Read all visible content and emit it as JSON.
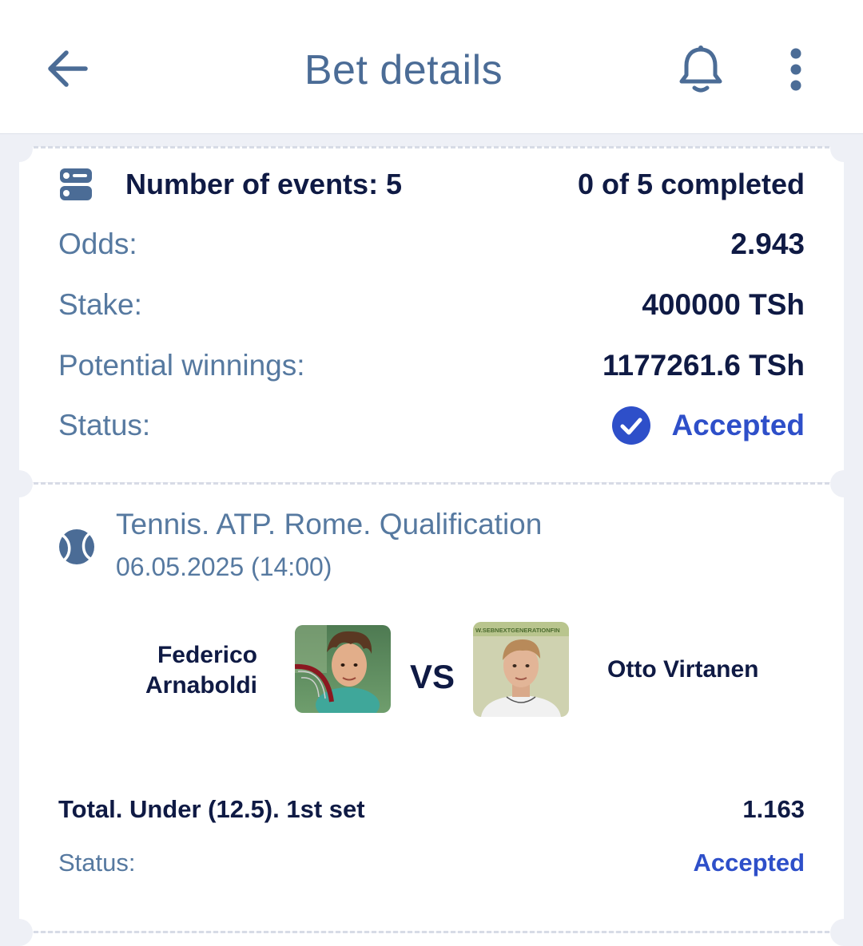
{
  "header": {
    "title": "Bet details",
    "back_icon": "arrow-left-icon",
    "bell_icon": "bell-icon",
    "more_icon": "more-vertical-icon"
  },
  "summary": {
    "events_label": "Number of events: 5",
    "completed": "0 of 5 completed",
    "odds_label": "Odds:",
    "odds_value": "2.943",
    "stake_label": "Stake:",
    "stake_value": "400000 TSh",
    "winnings_label": "Potential winnings:",
    "winnings_value": "1177261.6 TSh",
    "status_label": "Status:",
    "status_value": "Accepted"
  },
  "event": {
    "league": "Tennis. ATP. Rome. Qualification",
    "date": "06.05.2025 (14:00)",
    "player1": "Federico Arnaboldi",
    "vs": "VS",
    "player2": "Otto Virtanen",
    "photo2_banner": "W.SEBNEXTGENERATIONFIN",
    "market": "Total. Under (12.5). 1st set",
    "market_odds": "1.163",
    "status_label": "Status:",
    "status_value": "Accepted"
  },
  "colors": {
    "accent": "#2e4fc9",
    "label": "#5679a0",
    "text": "#0f1a44",
    "background": "#eef0f6"
  }
}
